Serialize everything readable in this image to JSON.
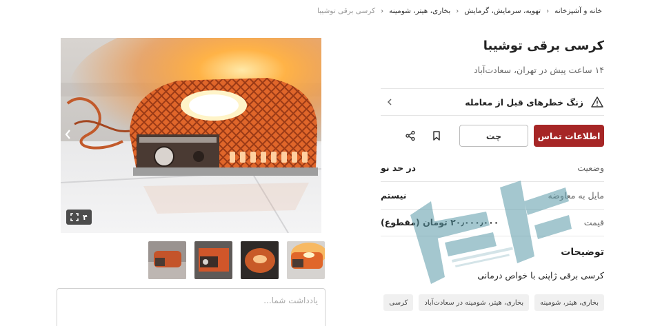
{
  "breadcrumb": [
    "خانه و آشپزخانه",
    "تهویه، سرمایش، گرمایش",
    "بخاری، هیتر، شومینه",
    "کرسی برقی توشیبا"
  ],
  "title": "کرسی برقی توشیبا",
  "subtitle": "۱۴ ساعت پیش در تهران، سعادت‌آباد",
  "warning": {
    "label": "زنگ خطرهای قبل از معامله",
    "icon": "warning-triangle-icon"
  },
  "actions": {
    "contact_label": "اطلاعات تماس",
    "chat_label": "چت",
    "bookmark_icon": "bookmark-icon",
    "share_icon": "share-icon"
  },
  "info": [
    {
      "key": "وضعیت",
      "value": "در حد نو"
    },
    {
      "key": "مایل به معاوضه",
      "value": "نیستم"
    },
    {
      "key": "قیمت",
      "value": "۲۰٫۰۰۰٫۰۰۰ تومان (مقطوع)"
    }
  ],
  "description": {
    "title": "توضیحات",
    "body": "کرسی برقی ژاپنی با خواص درمانی"
  },
  "tags": [
    "بخاری، هیتر، شومینه",
    "بخاری، هیتر، شومینه در سعادت‌آباد",
    "کرسی"
  ],
  "gallery": {
    "photo_count": "۴",
    "expand_icon": "expand-icon",
    "thumb_count": 4
  },
  "notes": {
    "placeholder": "یادداشت شما..."
  },
  "colors": {
    "accent": "#a62626",
    "watermark": "#5a9aa8"
  }
}
